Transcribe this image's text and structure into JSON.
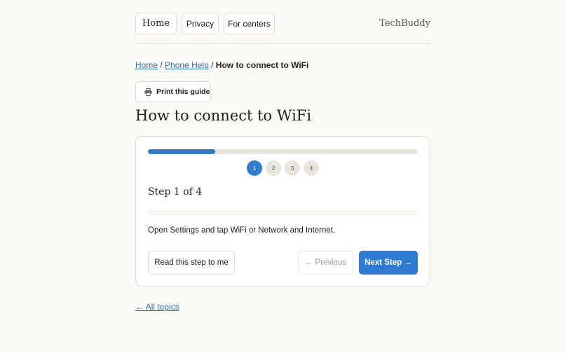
{
  "nav": {
    "home": "Home",
    "privacy": "Privacy",
    "centers": "For centers",
    "brand": "TechBuddy"
  },
  "breadcrumb": {
    "home": "Home",
    "sep1": "/",
    "phone_help": "Phone Help",
    "sep2": "/",
    "current": "How to connect to WiFi"
  },
  "print_label": "Print this guide",
  "title": "How to connect to WiFi",
  "progress_fraction": 0.25,
  "steps": [
    "1",
    "2",
    "3",
    "4"
  ],
  "active_step": 1,
  "step_heading": "Step 1 of 4",
  "instruction": "Open Settings and tap WiFi or Network and Internet.",
  "buttons": {
    "read": "Read this step to me",
    "previous": "← Previous",
    "next": "Next Step →"
  },
  "all_topics": "← All topics",
  "colors": {
    "accent": "#2f7bd1",
    "link": "#2f6fbd"
  },
  "icons": {
    "print": "printer-icon"
  }
}
